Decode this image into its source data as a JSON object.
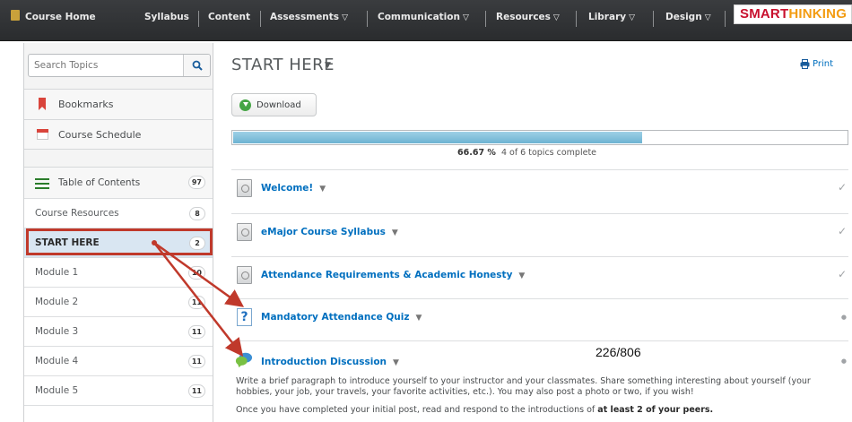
{
  "nav": {
    "course_home": "Course Home",
    "items": [
      {
        "label": "Syllabus",
        "dropdown": false
      },
      {
        "label": "Content",
        "dropdown": false
      },
      {
        "label": "Assessments",
        "dropdown": true
      },
      {
        "label": "Communication",
        "dropdown": true
      },
      {
        "label": "Resources",
        "dropdown": true
      },
      {
        "label": "Library",
        "dropdown": true
      },
      {
        "label": "Design",
        "dropdown": true
      }
    ],
    "caret_glyph": "▽",
    "logo_part1": "SMART",
    "logo_part2": "HINKING"
  },
  "sidebar": {
    "search_placeholder": "Search Topics",
    "bookmarks": "Bookmarks",
    "course_schedule": "Course Schedule",
    "toc_label": "Table of Contents",
    "toc_count": "97",
    "modules": [
      {
        "label": "Course Resources",
        "count": "8"
      },
      {
        "label": "START HERE",
        "count": "2",
        "active": true
      },
      {
        "label": "Module 1",
        "count": "10"
      },
      {
        "label": "Module 2",
        "count": "11"
      },
      {
        "label": "Module 3",
        "count": "11"
      },
      {
        "label": "Module 4",
        "count": "11"
      },
      {
        "label": "Module 5",
        "count": "11"
      }
    ]
  },
  "main": {
    "title": "START HERE",
    "title_caret": "▼",
    "print": "Print",
    "download": "Download",
    "progress": {
      "fraction": 0.6667,
      "percent_text": "66.67 %",
      "summary": "4 of 6 topics complete"
    },
    "topics": [
      {
        "name": "Welcome!",
        "icon": "document-icon",
        "status": "✓"
      },
      {
        "name": "eMajor Course Syllabus",
        "icon": "document-icon",
        "status": "✓"
      },
      {
        "name": "Attendance Requirements & Academic Honesty",
        "icon": "document-icon",
        "status": "✓"
      },
      {
        "name": "Mandatory Attendance Quiz",
        "icon": "quiz-icon",
        "status": "●"
      },
      {
        "name": "Introduction Discussion",
        "icon": "discussion-icon",
        "status": "●"
      }
    ],
    "topic_caret": "▼",
    "discussion_text_1": "Write a brief paragraph to introduce yourself to your instructor and your classmates.  Share something interesting about yourself (your hobbies, your job, your travels, your favorite activities, etc.). You may also post a photo or two, if you wish!",
    "discussion_text_2a": "Once you have completed your initial post, read and respond to the introductions of ",
    "discussion_text_2b": "at least 2 of your peers."
  },
  "overlay": {
    "counter": "226/806"
  },
  "colors": {
    "nav_bg": "#2f3133",
    "link_blue": "#006fbf",
    "annotation_red": "#c0392b",
    "progress_fill": "#7fbfdb",
    "active_row": "#d9e6f2"
  }
}
